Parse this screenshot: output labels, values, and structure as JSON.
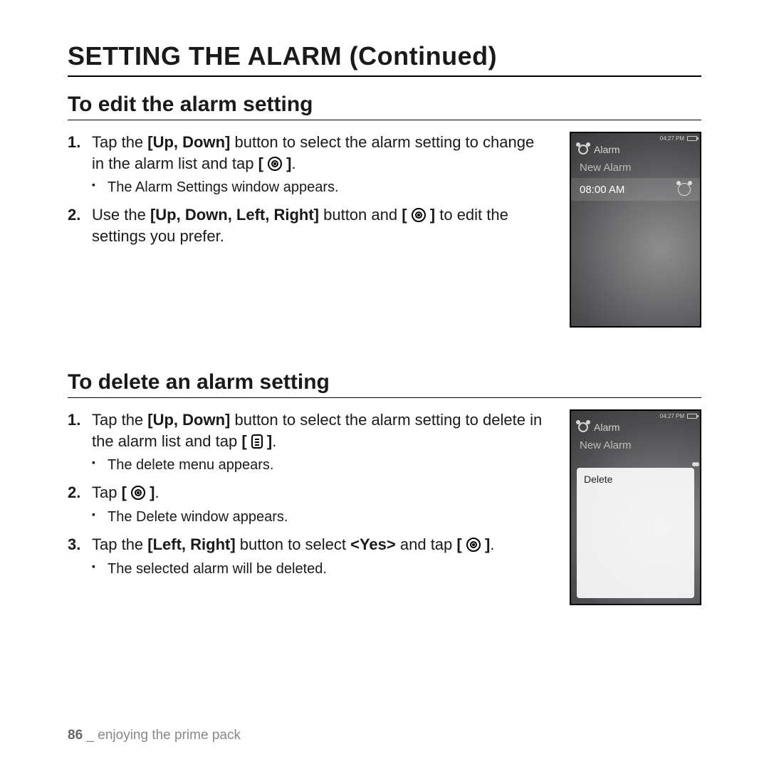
{
  "page_title": "SETTING THE ALARM (Continued)",
  "sections": {
    "edit": {
      "title": "To edit the alarm setting",
      "step1_a": "Tap the ",
      "step1_b": "[Up, Down]",
      "step1_c": " button to select the alarm setting to change in the alarm list and tap ",
      "step1_sub": "The Alarm Settings window appears.",
      "step2_a": "Use the ",
      "step2_b": "[Up, Down, Left, Right]",
      "step2_c": " button and ",
      "step2_d": " to edit the settings you prefer."
    },
    "delete": {
      "title": "To delete an alarm setting",
      "step1_a": "Tap the ",
      "step1_b": "[Up, Down]",
      "step1_c": " button to select the alarm setting to delete in the alarm list and tap ",
      "step1_sub": "The delete menu appears.",
      "step2_a": "Tap ",
      "step2_sub": "The Delete window appears.",
      "step3_a": "Tap the ",
      "step3_b": "[Left, Right]",
      "step3_c": " button to select ",
      "step3_d": "<Yes>",
      "step3_e": " and tap ",
      "step3_sub": "The selected alarm will be deleted."
    }
  },
  "device": {
    "status_time": "04:27 PM",
    "header": "Alarm",
    "row_new": "New Alarm",
    "row_time": "08:00 AM",
    "popup_delete": "Delete"
  },
  "footer": {
    "page": "86",
    "sep": "_",
    "chapter": "enjoying the prime pack"
  },
  "brackets": {
    "open": "[",
    "close": "]",
    "dot": "."
  }
}
